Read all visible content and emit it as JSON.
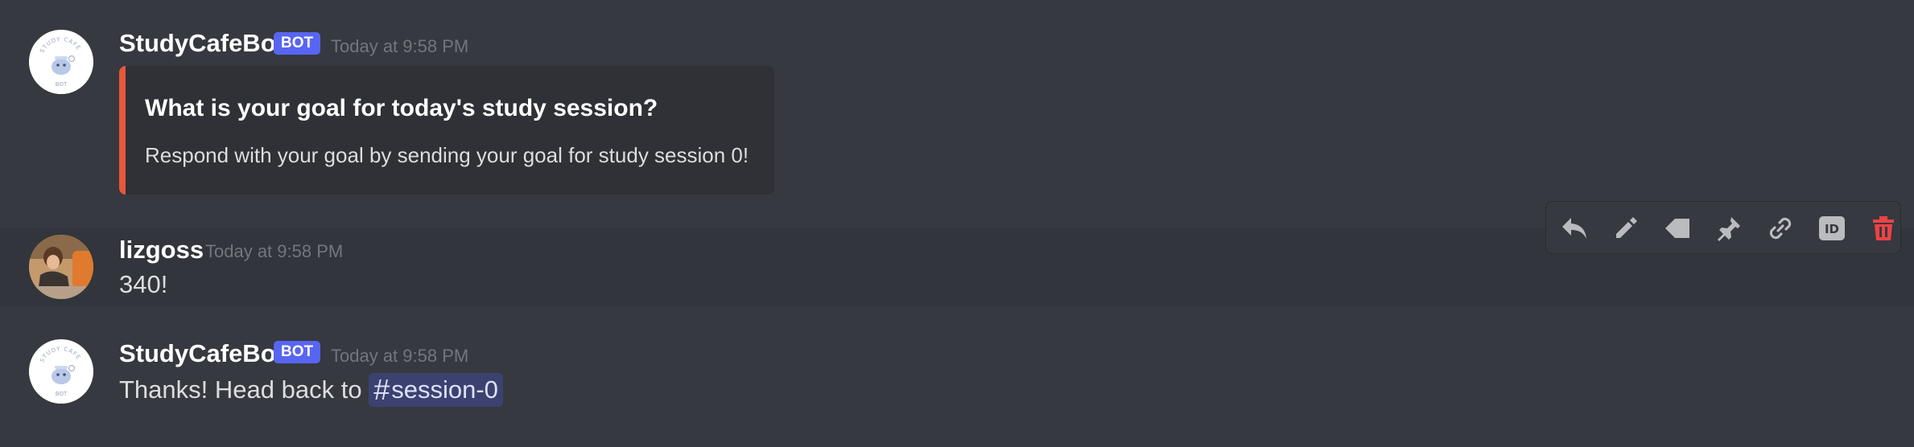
{
  "messages": [
    {
      "author": "StudyCafeBot",
      "is_bot": true,
      "bot_tag": "BOT",
      "timestamp": "Today at 9:58 PM",
      "embed": {
        "accent_color": "#e8573c",
        "title": "What is your goal for today's study session?",
        "description": "Respond with your goal by sending your goal for study session 0!"
      }
    },
    {
      "author": "lizgoss",
      "is_bot": false,
      "timestamp": "Today at 9:58 PM",
      "content": "340!"
    },
    {
      "author": "StudyCafeBot",
      "is_bot": true,
      "bot_tag": "BOT",
      "timestamp": "Today at 9:58 PM",
      "content_prefix": "Thanks! Head back to",
      "channel_mention": {
        "hash": "#",
        "name": "session-0"
      }
    }
  ],
  "bot_avatar_text": {
    "top": "STUDY CAFE",
    "bottom": "BOT"
  },
  "message_toolbar": {
    "icons": [
      "reply-icon",
      "edit-icon",
      "tag-icon",
      "pin-icon",
      "link-icon",
      "id-icon",
      "delete-icon"
    ],
    "id_label": "ID"
  },
  "colors": {
    "background": "#36393f",
    "embed_background": "#2f3136",
    "bot_tag": "#5865f2",
    "mention_background": "#3c4270",
    "delete": "#ed4245"
  }
}
